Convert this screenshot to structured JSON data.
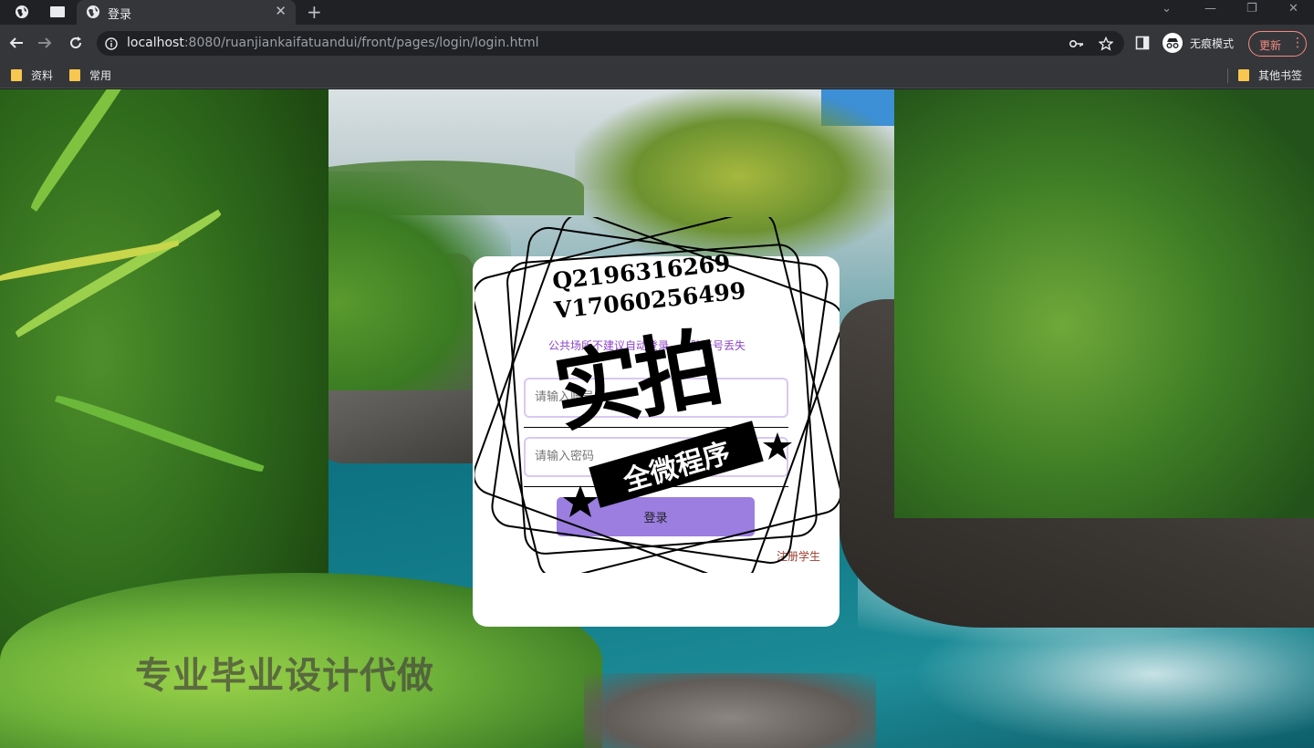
{
  "browser": {
    "tab_title": "登录",
    "url_host": "localhost",
    "url_rest": ":8080/ruanjiankaifatuandui/front/pages/login/login.html",
    "incognito_label": "无痕模式",
    "update_label": "更新",
    "bookmarks": [
      {
        "label": "资料"
      },
      {
        "label": "常用"
      }
    ],
    "other_bookmarks_label": "其他书签",
    "accent_update": "#f28b82"
  },
  "login": {
    "notice": "公共场所不建议自动登录，以防账号丢失",
    "username_placeholder": "请输入账号",
    "password_placeholder": "请输入密码",
    "login_button": "登录",
    "register_link": "注册学生",
    "button_color": "#9b7ee0"
  },
  "overlay": {
    "qq": "Q2196316269",
    "wechat": "V17060256499",
    "stamp_title": "实拍",
    "stamp_ribbon": "全微程序",
    "bottom_watermark": "专业毕业设计代做"
  }
}
